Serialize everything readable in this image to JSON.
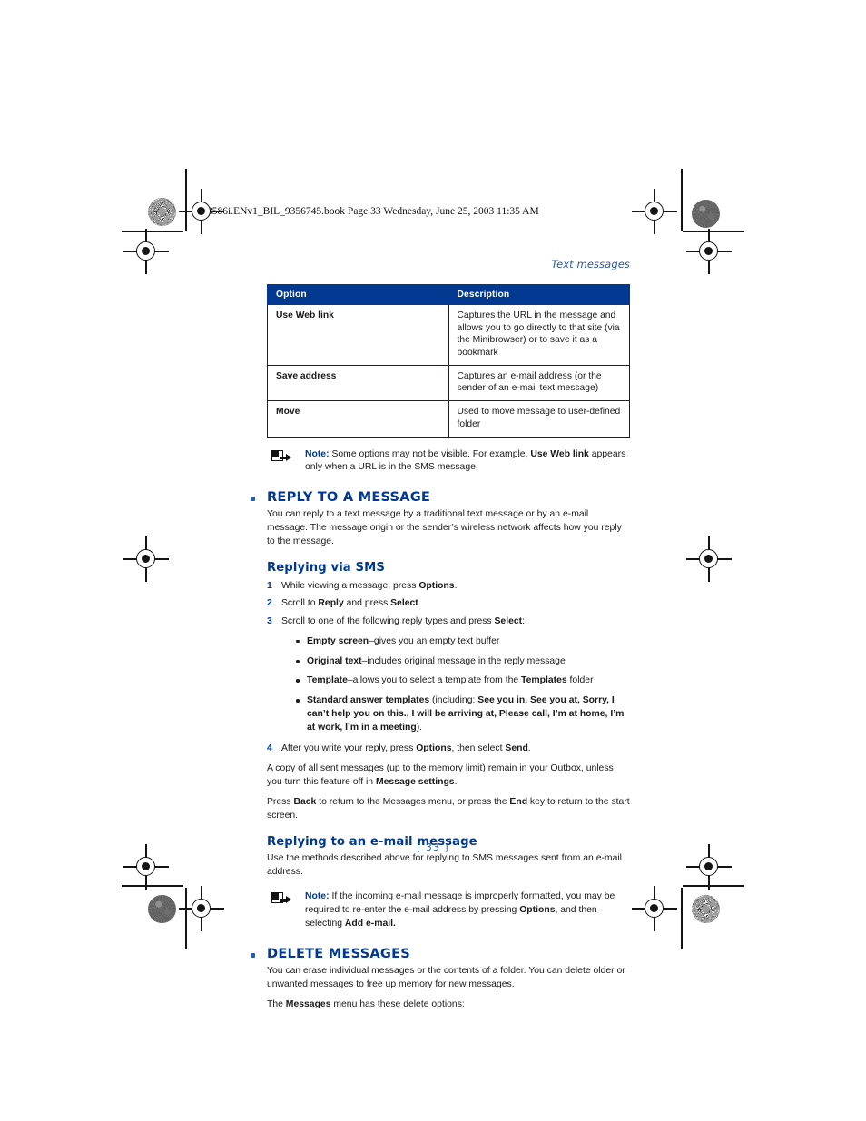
{
  "book_header": "3586i.ENv1_BIL_9356745.book  Page 33  Wednesday, June 25, 2003  11:35 AM",
  "running_head": "Text messages",
  "folio": "[ 33 ]",
  "colors": {
    "heading_blue": "#00398f",
    "accent_blue": "#2d5aa8",
    "table_header_bg": "#00398f",
    "body_text": "#1a1a1a"
  },
  "table": {
    "headers": [
      "Option",
      "Description"
    ],
    "rows": [
      {
        "option": "Use Web link",
        "description": "Captures the URL in the message and allows you to go directly to that site (via the Minibrowser) or to save it as a bookmark"
      },
      {
        "option": "Save address",
        "description": "Captures an e-mail address (or the sender of an e-mail text message)"
      },
      {
        "option": "Move",
        "description": "Used to move message to user-defined folder"
      }
    ]
  },
  "note1": {
    "label": "Note:",
    "text_a": " Some options may not be visible. For example, ",
    "bold_a": "Use Web link",
    "text_b": " appears only when a URL is in the SMS message."
  },
  "section_reply": {
    "heading": "REPLY TO A MESSAGE",
    "intro": "You can reply to a text message by a traditional text message or by an e-mail message. The message origin or the sender’s wireless network affects how you reply to the message."
  },
  "sub_sms": {
    "heading": "Replying via SMS",
    "steps": [
      {
        "num": "1",
        "pre": "While viewing a message, press ",
        "bold": "Options",
        "post": "."
      },
      {
        "num": "2",
        "pre": "Scroll to ",
        "bold": "Reply",
        "mid": " and press ",
        "bold2": "Select",
        "post": "."
      },
      {
        "num": "3",
        "pre": "Scroll to one of the following reply types and press ",
        "bold": "Select",
        "post": ":"
      }
    ],
    "bullets": [
      {
        "bold": "Empty screen",
        "text": "–gives you an empty text buffer"
      },
      {
        "bold": "Original text",
        "text": "–includes original message in the reply message"
      },
      {
        "bold": "Template",
        "text": "–allows you to select a template from the ",
        "bold2": "Templates",
        "text2": " folder"
      },
      {
        "bold": "Standard answer templates",
        "text": " (including: ",
        "bold2": "See you in, See you at, Sorry, I can’t help you on this., I will be arriving at, Please call, I’m at home, I’m at work, I’m in a meeting",
        "text2": ")."
      }
    ],
    "step4": {
      "num": "4",
      "pre": "After you write your reply, press ",
      "bold": "Options",
      "mid": ", then select ",
      "bold2": "Send",
      "post": "."
    },
    "para_outbox_a": "A copy of all sent messages (up to the memory limit) remain in your Outbox, unless you turn this feature off in ",
    "para_outbox_bold": "Message settings",
    "para_outbox_b": ".",
    "para_back_a": "Press ",
    "para_back_bold1": "Back",
    "para_back_b": " to return to the Messages menu, or press the ",
    "para_back_bold2": "End",
    "para_back_c": " key to return to the start screen."
  },
  "sub_email": {
    "heading": "Replying to an e-mail message",
    "text": "Use the methods described above for replying to SMS messages sent from an e-mail address."
  },
  "note2": {
    "label": "Note:",
    "text_a": " If the incoming e-mail message is improperly formatted, you may be required to re-enter the e-mail address by pressing ",
    "bold_a": "Options",
    "text_b": ", and then selecting ",
    "bold_b": "Add e-mail."
  },
  "section_delete": {
    "heading": "DELETE MESSAGES",
    "intro": "You can erase individual messages or the contents of a folder. You can delete older or unwanted messages to free up memory for new messages.",
    "lead_a": "The ",
    "lead_bold": "Messages",
    "lead_b": " menu has these delete options:"
  }
}
